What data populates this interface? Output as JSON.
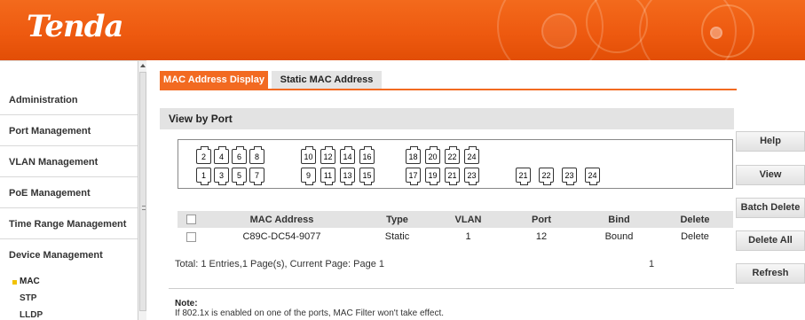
{
  "header": {
    "logo": "Tenda"
  },
  "sidebar": {
    "items": [
      {
        "label": "Administration"
      },
      {
        "label": "Port Management"
      },
      {
        "label": "VLAN Management"
      },
      {
        "label": "PoE Management"
      },
      {
        "label": "Time Range Management"
      },
      {
        "label": "Device Management"
      }
    ],
    "subitems": [
      {
        "label": "MAC",
        "active": true
      },
      {
        "label": "STP"
      },
      {
        "label": "LLDP"
      }
    ]
  },
  "tabs": [
    {
      "label": "MAC Address Display",
      "active": true
    },
    {
      "label": "Static MAC Address",
      "active": false
    }
  ],
  "section": {
    "title": "View by Port"
  },
  "ports": {
    "top": [
      "2",
      "4",
      "6",
      "8",
      "10",
      "12",
      "14",
      "16",
      "18",
      "20",
      "22",
      "24"
    ],
    "bottom": [
      "1",
      "3",
      "5",
      "7",
      "9",
      "11",
      "13",
      "15",
      "17",
      "19",
      "21",
      "23"
    ],
    "extra": [
      "21",
      "22",
      "23",
      "24"
    ]
  },
  "table": {
    "headers": [
      "MAC Address",
      "Type",
      "VLAN",
      "Port",
      "Bind",
      "Delete"
    ],
    "rows": [
      {
        "mac": "C89C-DC54-9077",
        "type": "Static",
        "vlan": "1",
        "port": "12",
        "bind": "Bound",
        "delete": "Delete"
      }
    ]
  },
  "pagination": {
    "summary": "Total: 1 Entries,1 Page(s), Current Page: Page 1",
    "page": "1"
  },
  "note": {
    "title": "Note:",
    "text": "If 802.1x is enabled on one of the ports, MAC Filter won't take effect."
  },
  "buttons": {
    "help": "Help",
    "view": "View",
    "batch_delete": "Batch Delete",
    "delete_all": "Delete All",
    "refresh": "Refresh"
  },
  "colors": {
    "accent": "#f26a21",
    "header": "#ee5a10"
  }
}
